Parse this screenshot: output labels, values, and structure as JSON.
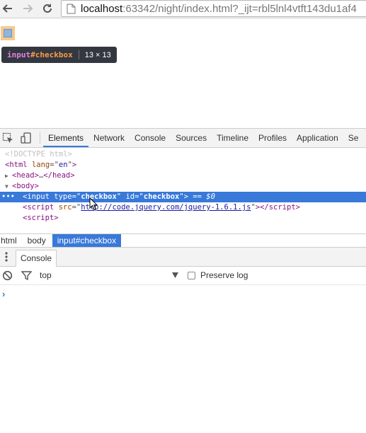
{
  "browser": {
    "url_host": "localhost",
    "url_rest": ":63342/night/index.html?_ijt=rbl5lnl4vtft143du1af4"
  },
  "page": {
    "tooltip": {
      "tag": "input",
      "id": "#checkbox",
      "dimensions": "13 × 13"
    }
  },
  "devtools": {
    "tabs": [
      "Elements",
      "Network",
      "Console",
      "Sources",
      "Timeline",
      "Profiles",
      "Application",
      "Se"
    ],
    "dom": {
      "doctype": "<!DOCTYPE html>",
      "html_tag": "html",
      "html_lang_attr": "lang",
      "html_lang_val": "en",
      "head_tag": "head",
      "head_ellipsis": "…",
      "body_tag": "body",
      "input_tag": "input",
      "input_type_attr": "type",
      "input_type_val": "checkbox",
      "input_id_attr": "id",
      "input_id_val": "checkbox",
      "selected_marker": " == $0",
      "script_tag": "script",
      "script_src_attr": "src",
      "script_src_val": "http://code.jquery.com/jquery-1.6.1.js",
      "script2_tag": "script",
      "ellipsis_marker": "•••"
    },
    "breadcrumbs": [
      "html",
      "body",
      "input#checkbox"
    ],
    "drawer_tab": "Console",
    "console": {
      "context": "top",
      "preserve_log_label": "Preserve log",
      "prompt": "›"
    },
    "accent_color": "#3879d9"
  }
}
